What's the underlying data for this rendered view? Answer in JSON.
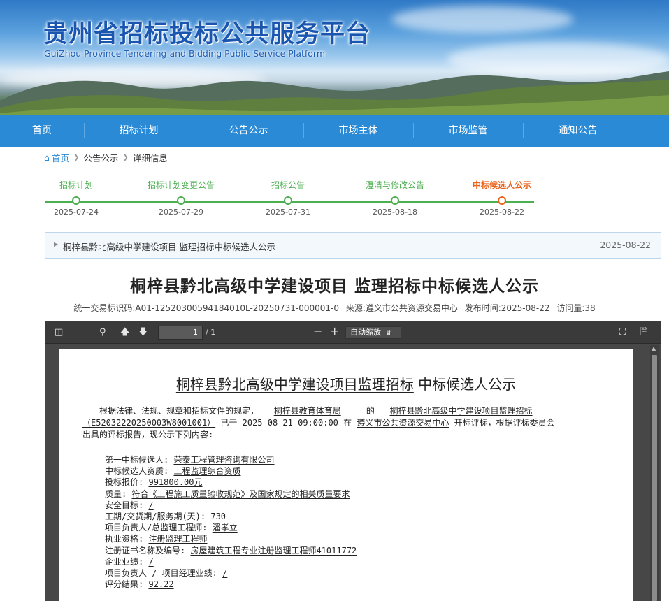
{
  "banner": {
    "title_cn": "贵州省招标投标公共服务平台",
    "title_en": "GuiZhou Province Tendering and Bidding Public Service Platform"
  },
  "nav": [
    "首页",
    "招标计划",
    "公告公示",
    "市场主体",
    "市场监管",
    "通知公告"
  ],
  "breadcrumb": {
    "home": "首页",
    "level2": "公告公示",
    "level3": "详细信息"
  },
  "timeline": [
    {
      "label": "招标计划",
      "date": "2025-07-24",
      "active": false
    },
    {
      "label": "招标计划变更公告",
      "date": "2025-07-29",
      "active": false
    },
    {
      "label": "招标公告",
      "date": "2025-07-31",
      "active": false
    },
    {
      "label": "澄清与修改公告",
      "date": "2025-08-18",
      "active": false
    },
    {
      "label": "中标候选人公示",
      "date": "2025-08-22",
      "active": true
    }
  ],
  "notice": {
    "title": "桐梓县黔北高级中学建设项目 监理招标中标候选人公示",
    "date": "2025-08-22"
  },
  "article": {
    "title": "桐梓县黔北高级中学建设项目 监理招标中标候选人公示",
    "trade_id": "统一交易标识码:A01-12520300594184010L-20250731-000001-0",
    "source": "来源:遵义市公共资源交易中心",
    "pub_time": "发布时间:2025-08-22",
    "views": "访问量:38"
  },
  "pdf_viewer": {
    "page_current": "1",
    "page_total": "/ 1",
    "zoom": "自动缩放",
    "doc": {
      "title_underlined": "桐梓县黔北高级中学建设项目监理招标",
      "title_rest": "中标候选人公示",
      "p1_a": "根据法律、法规、规章和招标文件的规定，",
      "p1_org": "桐梓县教育体育局",
      "p1_b": "的",
      "p1_proj": "桐梓县黔北高级中学建设项目监理招标",
      "p2_code": "（E5203222025000­3W8001001）",
      "p2_a": "已于 2025-08-21 09:00:00 在",
      "p2_venue": "遵义市公共资源交易中心",
      "p2_b": "开标评标，根据评标委员会",
      "p3": "出具的评标报告，现公示下列内容:",
      "fields": [
        {
          "k": "第一中标候选人:",
          "v": "荣泰工程管理咨询有限公司"
        },
        {
          "k": "中标候选人资质:",
          "v": "工程监理综合资质"
        },
        {
          "k": "投标报价:",
          "v": "991800.00元"
        },
        {
          "k": "质量:",
          "v": "符合《工程施工质量验收规范》及国家规定的相关质量要求"
        },
        {
          "k": "安全目标:",
          "v": "/"
        },
        {
          "k": "工期/交货期/服务期(天):",
          "v": "730"
        },
        {
          "k": "项目负责人/总监理工程师:",
          "v": "潘孝立"
        },
        {
          "k": "执业资格:",
          "v": "注册监理工程师"
        },
        {
          "k": "注册证书名称及编号:",
          "v": "房屋建筑工程专业注册监理工程师41011772"
        },
        {
          "k": "企业业绩:",
          "v": "/"
        },
        {
          "k": "项目负责人 / 项目经理业绩:",
          "v": "/"
        },
        {
          "k": "评分结果:",
          "v": "92.22"
        }
      ]
    }
  },
  "colors": {
    "nav": "#2a8ad6",
    "timeline_done": "#4caf50",
    "timeline_active": "#e8641d",
    "title_blue": "#1a56b0"
  }
}
